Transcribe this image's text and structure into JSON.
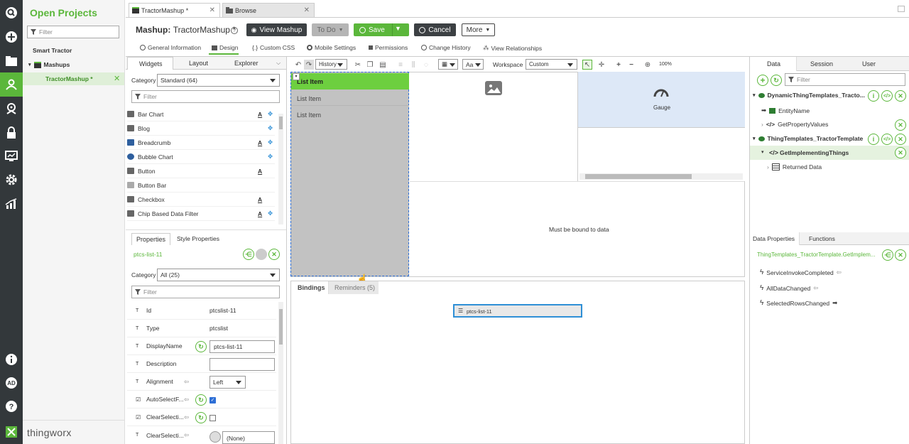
{
  "app": {
    "brand": "thingworx"
  },
  "rail": {
    "icons": [
      "search-icon",
      "plus-icon",
      "folder-icon",
      "projects-icon",
      "monitor-eye-icon",
      "lock-icon",
      "dashboard-icon",
      "gear-icon",
      "analytics-icon",
      "info-icon",
      "user-ad-icon",
      "help-icon"
    ]
  },
  "projects": {
    "title": "Open Projects",
    "filter_placeholder": "Filter",
    "tree": {
      "project": "Smart Tractor",
      "group": "Mashups",
      "item": "TractorMashup *"
    }
  },
  "tabs": [
    {
      "label": "TractorMashup *"
    },
    {
      "label": "Browse"
    }
  ],
  "header": {
    "mashup_label": "Mashup:",
    "mashup_name": "TractorMashup *",
    "view_mashup": "View Mashup",
    "todo": "To Do",
    "save": "Save",
    "cancel": "Cancel",
    "more": "More"
  },
  "subtabs": [
    "General Information",
    "Design",
    "Custom CSS",
    "Mobile Settings",
    "Permissions",
    "Change History",
    "View Relationships"
  ],
  "widgets_panel": {
    "tabs": [
      "Widgets",
      "Layout",
      "Explorer"
    ],
    "category_label": "Category",
    "category_value": "Standard (64)",
    "filter_placeholder": "Filter",
    "items": [
      "Bar Chart",
      "Blog",
      "Breadcrumb",
      "Bubble Chart",
      "Button",
      "Button Bar",
      "Checkbox",
      "Chip Based Data Filter"
    ]
  },
  "properties_panel": {
    "tabs": [
      "Properties",
      "Style Properties"
    ],
    "selected": "ptcs-list-11",
    "category_label": "Category",
    "category_value": "All (25)",
    "filter_placeholder": "Filter",
    "rows": [
      {
        "name": "Id",
        "value": "ptcslist-11"
      },
      {
        "name": "Type",
        "value": "ptcslist"
      },
      {
        "name": "DisplayName",
        "value": "ptcs-list-11"
      },
      {
        "name": "Description",
        "value": ""
      },
      {
        "name": "Alignment",
        "value": "Left"
      },
      {
        "name": "AutoSelectF...",
        "value": ""
      },
      {
        "name": "ClearSelecti...",
        "value": ""
      },
      {
        "name": "ClearSelecti...",
        "value": "(None)"
      }
    ]
  },
  "toolbar": {
    "history": "History",
    "workspace_label": "Workspace",
    "workspace_value": "Custom",
    "zoom": "100%"
  },
  "canvas": {
    "list_items": [
      "List Item",
      "List Item",
      "List Item"
    ],
    "gauge_label": "Gauge",
    "bound_message": "Must be bound to data"
  },
  "bindings": {
    "tabs": [
      "Bindings",
      "Reminders (5)"
    ],
    "node": "ptcs-list-11"
  },
  "data_panel": {
    "tabs": [
      "Data",
      "Session",
      "User"
    ],
    "filter_placeholder": "Filter",
    "tree": [
      "DynamicThingTemplates_Tracto...",
      "EntityName",
      "GetPropertyValues",
      "ThingTemplates_TractorTemplate",
      "GetImplementingThings",
      "Returned Data"
    ]
  },
  "data_props": {
    "tabs": [
      "Data Properties",
      "Functions"
    ],
    "service": "ThingTemplates_TractorTemplate.GetImplem...",
    "events": [
      "ServiceInvokeCompleted",
      "AllDataChanged",
      "SelectedRowsChanged"
    ]
  },
  "colors": {
    "accent": "#5bb73b",
    "rail": "#33383b",
    "selection": "#2e8fd6"
  }
}
